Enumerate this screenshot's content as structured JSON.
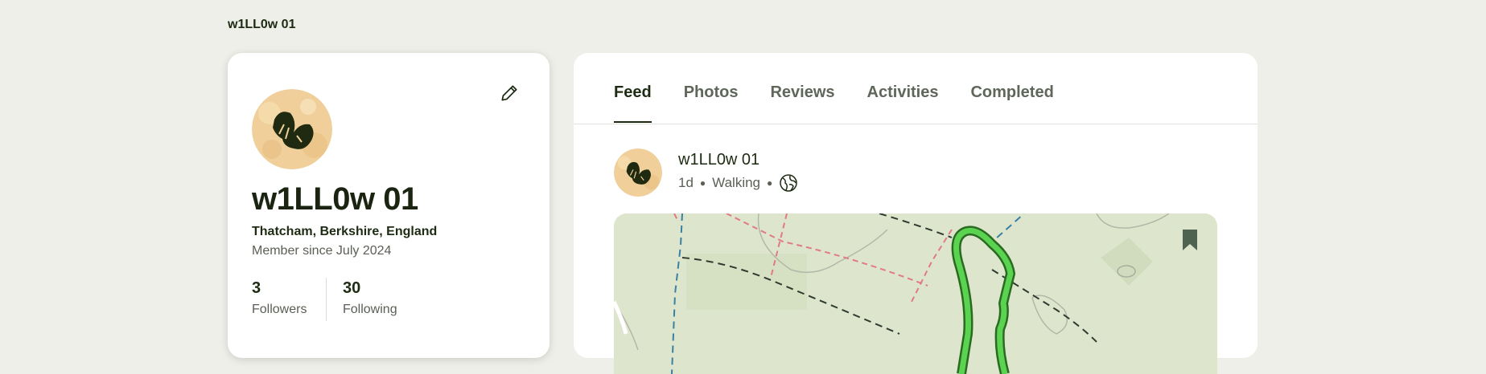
{
  "breadcrumb": {
    "label": "w1LL0w 01"
  },
  "profile": {
    "name": "w1LL0w 01",
    "location": "Thatcham, Berkshire, England",
    "member_since": "Member since July 2024",
    "followers": {
      "count": "3",
      "label": "Followers"
    },
    "following": {
      "count": "30",
      "label": "Following"
    }
  },
  "tabs": [
    {
      "label": "Feed",
      "active": true
    },
    {
      "label": "Photos",
      "active": false
    },
    {
      "label": "Reviews",
      "active": false
    },
    {
      "label": "Activities",
      "active": false
    },
    {
      "label": "Completed",
      "active": false
    }
  ],
  "post": {
    "author": "w1LL0w 01",
    "age": "1d",
    "activity": "Walking",
    "visibility_icon": "globe-icon"
  },
  "colors": {
    "background": "#efefe9",
    "brand_dark": "#1d2b12",
    "avatar_bg": "#f0cf9a",
    "route": "#4fd14a",
    "map_bg": "#dde6cc"
  }
}
